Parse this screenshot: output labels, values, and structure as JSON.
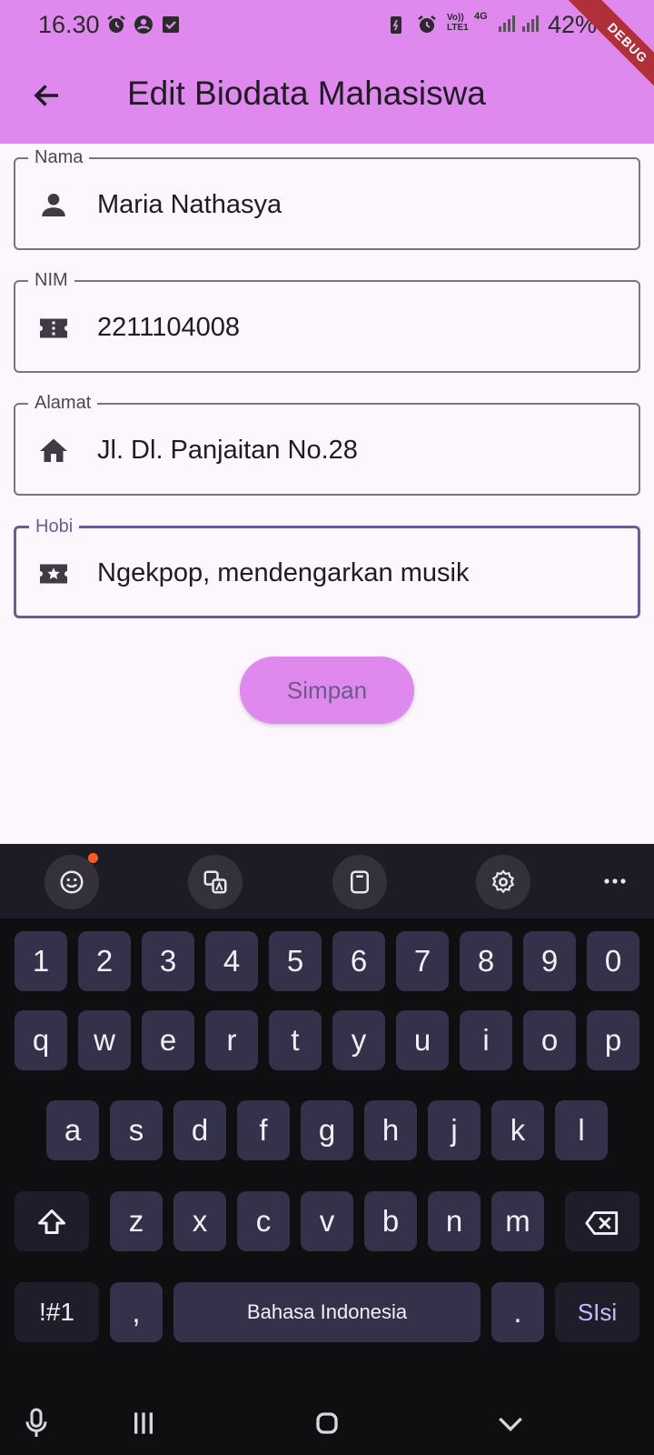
{
  "status_bar": {
    "time": "16.30",
    "volte": "Vo)) LTE1",
    "network": "4G",
    "battery": "42%"
  },
  "debug_banner": "DEBUG",
  "app_bar": {
    "title": "Edit Biodata Mahasiswa",
    "back_icon": "arrow-back-icon"
  },
  "form": {
    "fields": [
      {
        "label": "Nama",
        "value": "Maria Nathasya",
        "icon": "person-icon"
      },
      {
        "label": "NIM",
        "value": "2211104008",
        "icon": "badge-icon"
      },
      {
        "label": "Alamat",
        "value": "Jl. Dl. Panjaitan No.28",
        "icon": "home-icon"
      },
      {
        "label": "Hobi",
        "value": "Ngekpop, mendengarkan musik",
        "icon": "star-ticket-icon"
      }
    ],
    "save_label": "Simpan"
  },
  "keyboard": {
    "toolbar": [
      "emoji-icon",
      "translate-icon",
      "clipboard-icon",
      "settings-icon",
      "more-icon"
    ],
    "rows": [
      [
        "1",
        "2",
        "3",
        "4",
        "5",
        "6",
        "7",
        "8",
        "9",
        "0"
      ],
      [
        "q",
        "w",
        "e",
        "r",
        "t",
        "y",
        "u",
        "i",
        "o",
        "p"
      ],
      [
        "a",
        "s",
        "d",
        "f",
        "g",
        "h",
        "j",
        "k",
        "l"
      ],
      [
        "z",
        "x",
        "c",
        "v",
        "b",
        "n",
        "m"
      ]
    ],
    "symbols_label": "!#1",
    "comma_label": ",",
    "space_label": "Bahasa Indonesia",
    "period_label": ".",
    "action_label": "SIsi"
  },
  "colors": {
    "app_bar": "#df89ef",
    "background": "#fdf6fd",
    "focus": "#6c5b94",
    "keyboard_key": "#34314a"
  }
}
